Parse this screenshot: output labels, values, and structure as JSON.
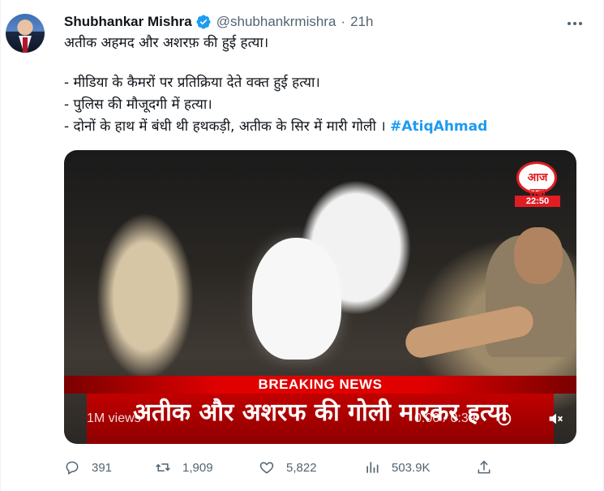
{
  "author": {
    "name": "Shubhankar Mishra",
    "handle": "@shubhankrmishra",
    "separator": "·",
    "time": "21h"
  },
  "tweet": {
    "line1": "अतीक अहमद और अशरफ़ की हुई हत्या।",
    "line2": "- मीडिया के कैमरों पर प्रतिक्रिया देते वक्त हुई हत्या।",
    "line3": "- पुलिस की मौजूदगी में हत्या।",
    "line4_text": "- दोनों के हाथ में बंधी थी हथकड़ी, अतीक के सिर में मारी गोली । ",
    "hashtag": "#AtiqAhmad"
  },
  "media": {
    "channel_logo": "आज तक",
    "clock": "22:50",
    "breaking": "BREAKING NEWS",
    "headline": "अतीक और अशरफ की गोली मारकर हत्या",
    "views": "1M views",
    "timeline": "0:06 / 0:39"
  },
  "actions": {
    "replies": "391",
    "retweets": "1,909",
    "likes": "5,822",
    "views": "503.9K"
  },
  "icons": {
    "verified": "verified-badge-icon",
    "more": "more-options-icon",
    "reply": "reply-icon",
    "retweet": "retweet-icon",
    "like": "heart-icon",
    "views": "views-chart-icon",
    "share": "share-icon"
  },
  "colors": {
    "accent": "#1d9bf0",
    "muted": "#536471",
    "breaking_red": "#e00000"
  }
}
